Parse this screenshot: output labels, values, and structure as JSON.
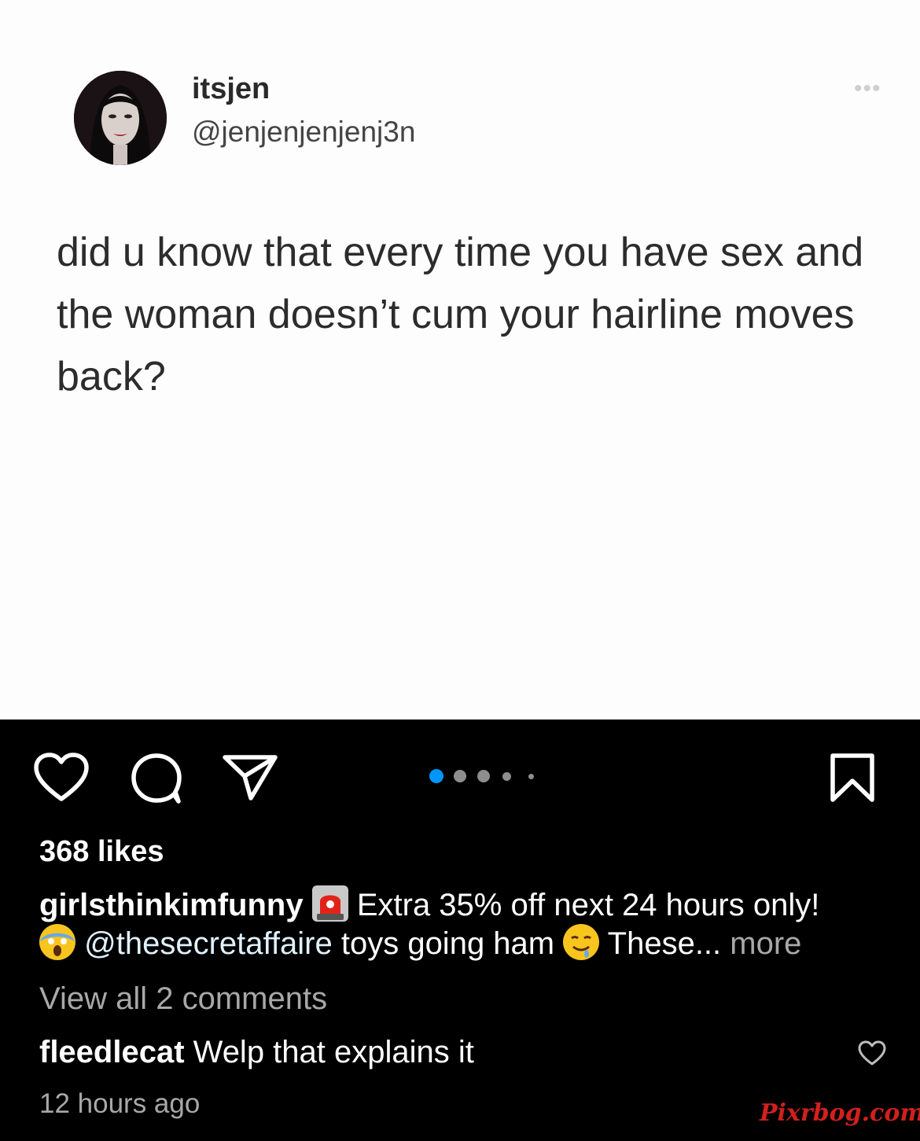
{
  "tweet": {
    "display_name": "itsjen",
    "handle": "@jenjenjenjenj3n",
    "more_icon": "ellipsis-icon",
    "text": "did u know that every time you have sex and the woman doesn’t cum your hairline moves back?"
  },
  "post": {
    "actions": {
      "like_icon": "heart-icon",
      "comment_icon": "comment-bubble-icon",
      "share_icon": "paper-plane-icon",
      "save_icon": "bookmark-icon"
    },
    "carousel": {
      "page_count": 5,
      "active_index": 0,
      "active_color": "#0095f6",
      "inactive_color": "#8e8e8e"
    },
    "likes": "368 likes",
    "caption": {
      "username": "girlsthinkimfunny",
      "emoji_siren": "siren-emoji",
      "text_part1": "Extra 35% off next 24 hours only!",
      "emoji_scream": "screaming-face-emoji",
      "mention": "@thesecretaffaire",
      "text_part2": "toys going ham",
      "emoji_drool": "drooling-face-emoji",
      "text_part3": "These...",
      "more_label": "more"
    },
    "view_all_comments": "View all 2 comments",
    "comment": {
      "username": "fleedlecat",
      "text": "Welp that explains it",
      "like_icon": "small-heart-icon"
    },
    "timestamp": "12 hours ago"
  },
  "watermark": "Pixrbog.com"
}
